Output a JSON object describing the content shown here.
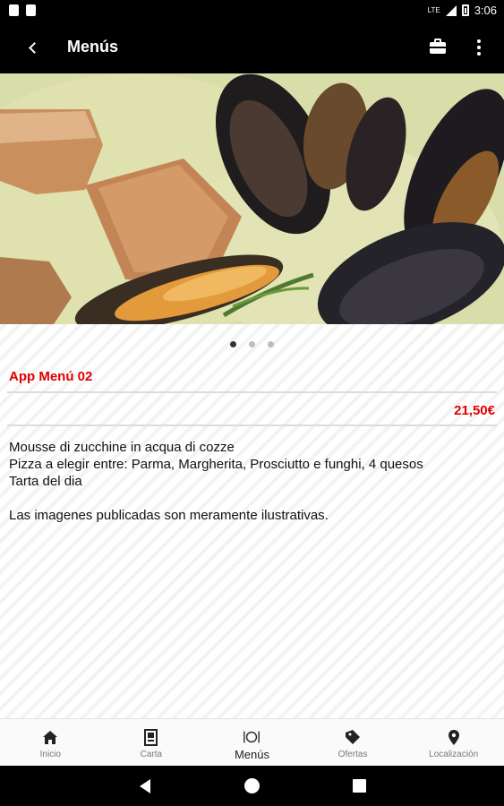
{
  "status_bar": {
    "time": "3:06",
    "network": "LTE"
  },
  "app_bar": {
    "title": "Menús",
    "back_icon": "arrow-back-icon",
    "action_icon": "briefcase-icon",
    "overflow_icon": "more-vert-icon"
  },
  "hero": {
    "image": "mussels-soup-photo",
    "slide_count": 3,
    "active_slide": 1
  },
  "menu": {
    "title": "App Menú 02",
    "price": "21,50€",
    "description": "Mousse di zucchine in acqua di cozze\nPizza a elegir entre: Parma, Margherita, Prosciutto e funghi, 4 quesos\nTarta del dia",
    "disclaimer": "Las imagenes publicadas son meramente ilustrativas."
  },
  "bottom_nav": {
    "items": [
      {
        "label": "Inicio",
        "icon": "home-icon"
      },
      {
        "label": "Carta",
        "icon": "menu-card-icon"
      },
      {
        "label": "Menús",
        "icon": "plate-cutlery-icon"
      },
      {
        "label": "Ofertas",
        "icon": "tag-icon"
      },
      {
        "label": "Localización",
        "icon": "location-pin-icon"
      }
    ],
    "active_index": 2
  },
  "colors": {
    "accent": "#e00000",
    "bar": "#000000"
  }
}
